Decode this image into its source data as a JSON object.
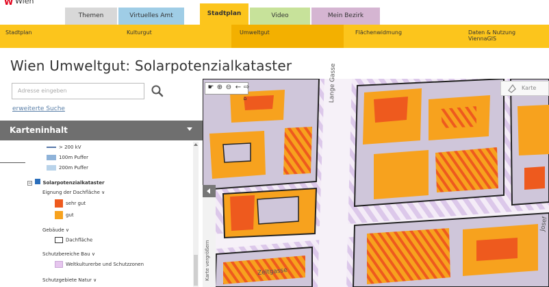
{
  "header": {
    "logo_text": "Wien",
    "logo_mark": "W"
  },
  "tabs": [
    {
      "label": "Themen",
      "color": "#d8d8d8"
    },
    {
      "label": "Virtuelles Amt",
      "color": "#9fcde6"
    },
    {
      "label": "Stadtplan",
      "color": "#fcc51c",
      "active": true
    },
    {
      "label": "Video",
      "color": "#c7e29a"
    },
    {
      "label": "Mein Bezirk",
      "color": "#d5b5d2"
    }
  ],
  "subnav": [
    {
      "label": "Stadtplan"
    },
    {
      "label": "Kulturgut"
    },
    {
      "label": "Umweltgut",
      "selected": true
    },
    {
      "label": "Flächenwidmung"
    },
    {
      "label": "Daten & Nutzung",
      "label2": "ViennaGIS"
    }
  ],
  "page_title": "Wien Umweltgut: Solarpotenzialkataster",
  "search": {
    "placeholder": "Adresse eingeben",
    "icon": "search-icon",
    "advanced_link": "erweiterte Suche"
  },
  "karteninhalt": {
    "label": "Karteninhalt",
    "icon": "chevron-down-icon"
  },
  "legend": {
    "rows": [
      {
        "label": "> 200 kV",
        "swatch": "#5577aa",
        "swatch_kind": "line"
      },
      {
        "label": "100m Puffer",
        "swatch": "#8fb3d9"
      },
      {
        "label": "200m Puffer",
        "swatch": "#b9d3ea"
      }
    ],
    "layer_name": "Solarpotenzialkataster",
    "group1_label": "Eignung der Dachfläche",
    "group1_items": [
      {
        "label": "sehr gut",
        "swatch": "#ee5a1e"
      },
      {
        "label": "gut",
        "swatch": "#f7a21e"
      }
    ],
    "group2_label": "Gebäude",
    "group2_items": [
      {
        "label": "Dachfläche",
        "swatch": "#ffffff"
      }
    ],
    "group3_label": "Schutzbereiche Bau",
    "group3_items": [
      {
        "label": "Weltkulturerbe und Schutzzonen",
        "swatch": "#e6c6ee"
      }
    ],
    "group4_label": "Schutzgebiete Natur"
  },
  "map": {
    "side_label": "Karte vergrößern",
    "karte_button": "Karte",
    "streets": [
      "Lange Gasse",
      "Zeltgasse",
      "Josef"
    ],
    "colors": {
      "hatch": "#dcc8ea",
      "building": "#cfc6da",
      "very_good": "#ee5a1e",
      "good": "#f7a21e"
    }
  }
}
